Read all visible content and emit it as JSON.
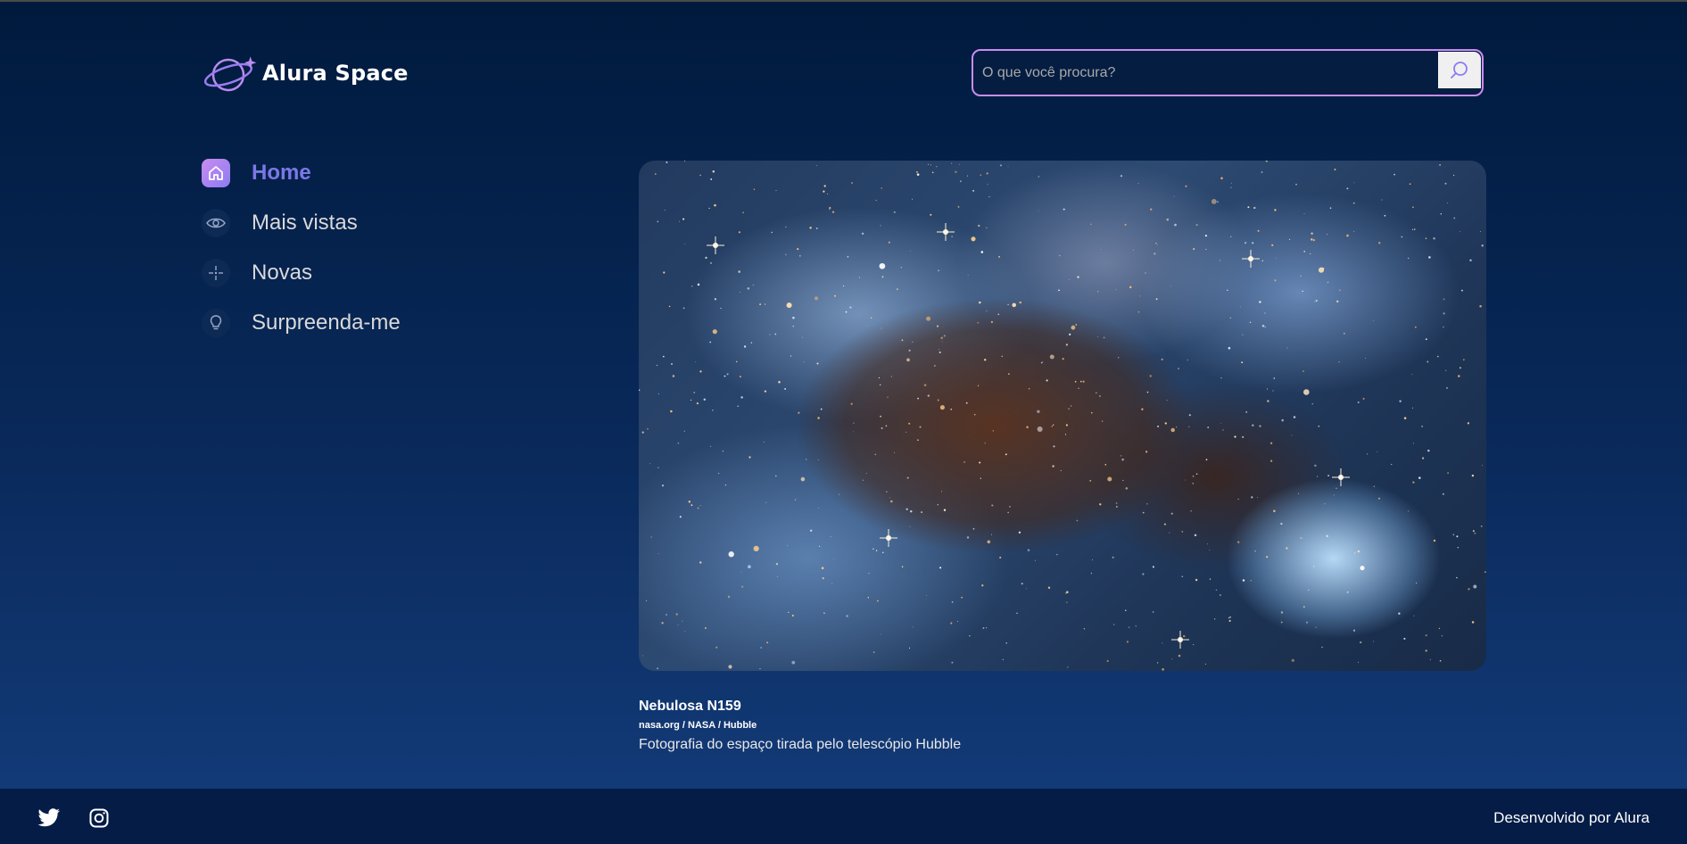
{
  "app": {
    "logo_text": "Alura Space"
  },
  "search": {
    "placeholder": "O que você procura?",
    "value": "",
    "icon": "search-icon"
  },
  "sidebar": {
    "items": [
      {
        "label": "Home",
        "icon": "home-icon",
        "active": true
      },
      {
        "label": "Mais vistas",
        "icon": "eye-icon",
        "active": false
      },
      {
        "label": "Novas",
        "icon": "sparkle-icon",
        "active": false
      },
      {
        "label": "Surpreenda-me",
        "icon": "lightbulb-icon",
        "active": false
      }
    ]
  },
  "featured": {
    "title": "Nebulosa N159",
    "source": "nasa.org / NASA / Hubble",
    "description": "Fotografia do espaço tirada pelo telescópio Hubble"
  },
  "footer": {
    "credit": "Desenvolvido por Alura",
    "social": [
      "twitter-icon",
      "instagram-icon"
    ]
  },
  "colors": {
    "accent": "#7b78e5",
    "accent_gradient_start": "#c98cf1",
    "search_border": "#c98cf1",
    "footer_bg": "#041c46",
    "page_bg_top": "#001a3d",
    "page_bg_bottom": "#143d7c"
  }
}
